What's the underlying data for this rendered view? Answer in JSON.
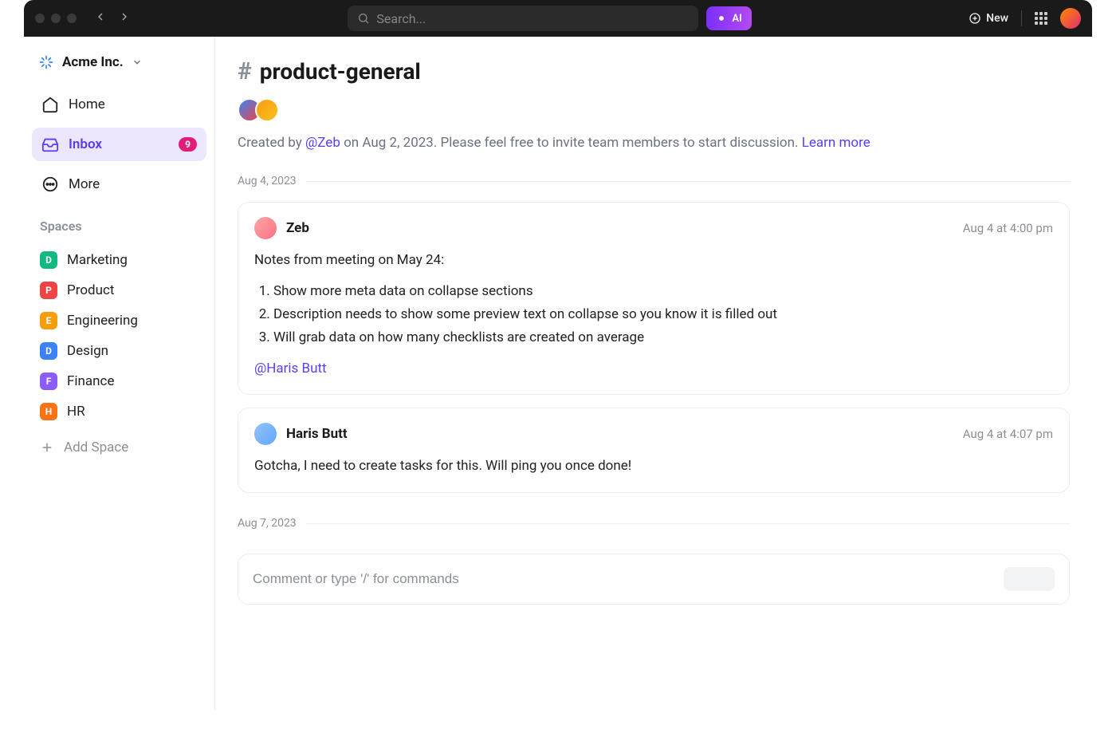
{
  "titlebar": {
    "search_placeholder": "Search...",
    "ai_label": "AI",
    "new_label": "New"
  },
  "sidebar": {
    "workspace_name": "Acme Inc.",
    "nav": {
      "home": "Home",
      "inbox": "Inbox",
      "inbox_badge": "9",
      "more": "More"
    },
    "spaces_label": "Spaces",
    "spaces": [
      {
        "letter": "D",
        "label": "Marketing",
        "color": "#10b981"
      },
      {
        "letter": "P",
        "label": "Product",
        "color": "#ef4444"
      },
      {
        "letter": "E",
        "label": "Engineering",
        "color": "#f59e0b"
      },
      {
        "letter": "D",
        "label": "Design",
        "color": "#3b82f6"
      },
      {
        "letter": "F",
        "label": "Finance",
        "color": "#8b5cf6"
      },
      {
        "letter": "H",
        "label": "HR",
        "color": "#f97316"
      }
    ],
    "add_space": "Add Space"
  },
  "channel": {
    "name": "product-general",
    "created_prefix": "Created by ",
    "created_by": "@Zeb",
    "created_mid": " on Aug 2, 2023. Please feel free to invite team members to start discussion. ",
    "learn_more": "Learn more"
  },
  "dates": {
    "d1": "Aug 4, 2023",
    "d2": "Aug 7, 2023"
  },
  "messages": [
    {
      "author": "Zeb",
      "time": "Aug 4 at 4:00 pm",
      "lead": "Notes from meeting on May 24:",
      "items": [
        "Show more meta data on collapse sections",
        "Description needs to show some preview text on collapse so you know it is filled out",
        "Will grab data on how many checklists are created on average"
      ],
      "mention": "@Haris Butt"
    },
    {
      "author": "Haris Butt",
      "time": "Aug 4 at 4:07 pm",
      "text": "Gotcha, I need to create tasks for this. Will ping you once done!"
    }
  ],
  "composer": {
    "placeholder": "Comment or type '/' for commands"
  }
}
